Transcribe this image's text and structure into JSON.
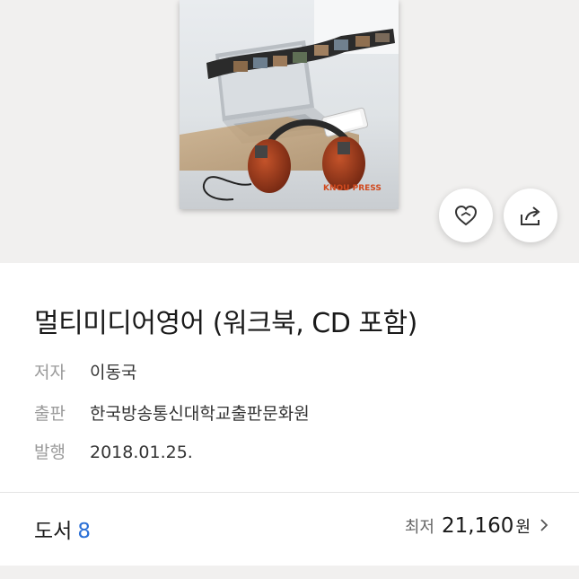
{
  "book": {
    "title": "멀티미디어영어 (워크북, CD 포함)",
    "cover_brand": "KNOU PRESS"
  },
  "meta": [
    {
      "key": "저자",
      "value": "이동국"
    },
    {
      "key": "출판",
      "value": "한국방송통신대학교출판문화원"
    },
    {
      "key": "발행",
      "value": "2018.01.25."
    }
  ],
  "actions": {
    "like_icon": "heart-icon",
    "share_icon": "share-icon"
  },
  "summary": {
    "books_label": "도서",
    "books_count": "8",
    "price_label": "최저",
    "price_amount": "21,160",
    "price_unit": "원"
  },
  "colors": {
    "accent": "#2a6fd6",
    "background": "#f1f0ef"
  }
}
